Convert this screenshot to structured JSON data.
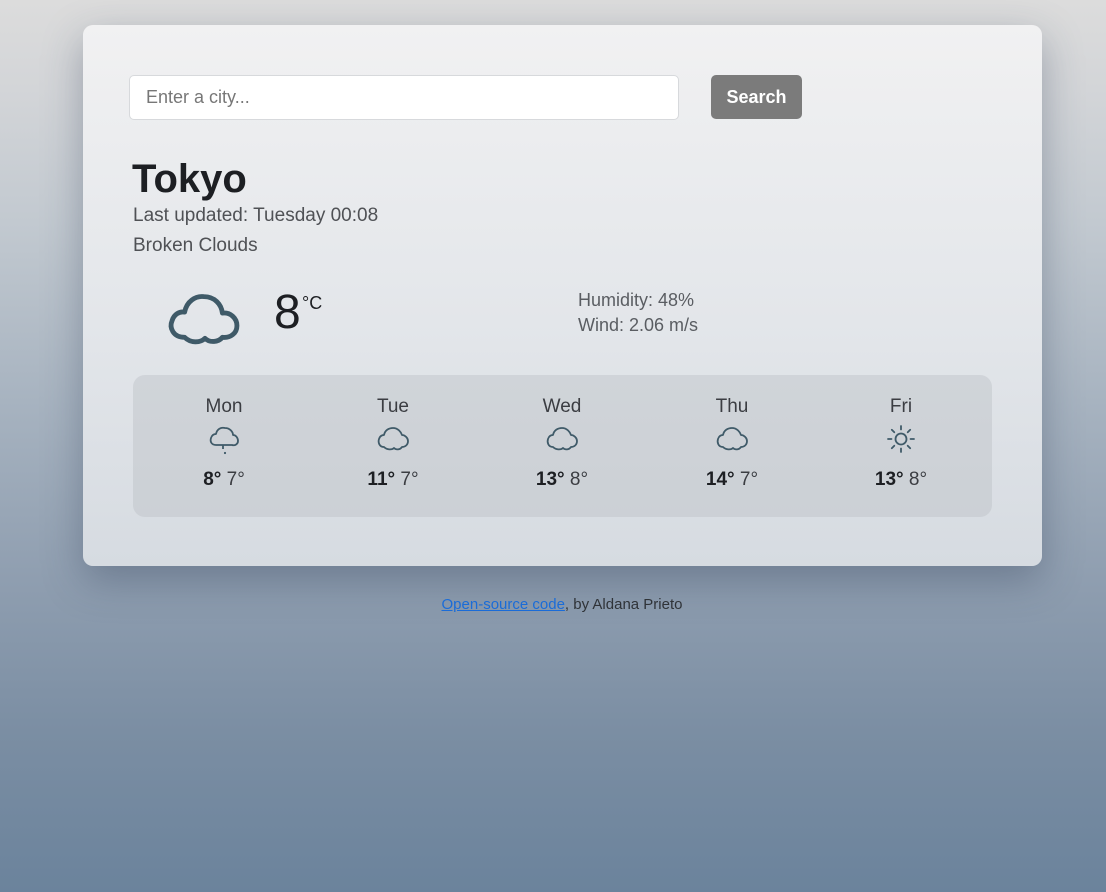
{
  "search": {
    "placeholder": "Enter a city...",
    "value": "",
    "button_label": "Search"
  },
  "current": {
    "city": "Tokyo",
    "updated_label": "Last updated:",
    "updated_time": "Tuesday 00:08",
    "description": "Broken Clouds",
    "icon": "cloud-icon",
    "temperature": "8",
    "unit": "°C",
    "humidity": "Humidity: 48%",
    "wind": "Wind: 2.06 m/s"
  },
  "forecast": [
    {
      "day": "Mon",
      "icon": "cloud-drizzle-icon",
      "max": "8°",
      "min": "7°"
    },
    {
      "day": "Tue",
      "icon": "cloud-icon",
      "max": "11°",
      "min": "7°"
    },
    {
      "day": "Wed",
      "icon": "cloud-icon",
      "max": "13°",
      "min": "8°"
    },
    {
      "day": "Thu",
      "icon": "cloud-icon",
      "max": "14°",
      "min": "7°"
    },
    {
      "day": "Fri",
      "icon": "sun-icon",
      "max": "13°",
      "min": "8°"
    }
  ],
  "footer": {
    "link_text": "Open-source code",
    "suffix": ", by Aldana Prieto"
  },
  "colors": {
    "icon": "#3f5a68",
    "search_button": "#7b7b7b",
    "link": "#1a6cd8"
  }
}
